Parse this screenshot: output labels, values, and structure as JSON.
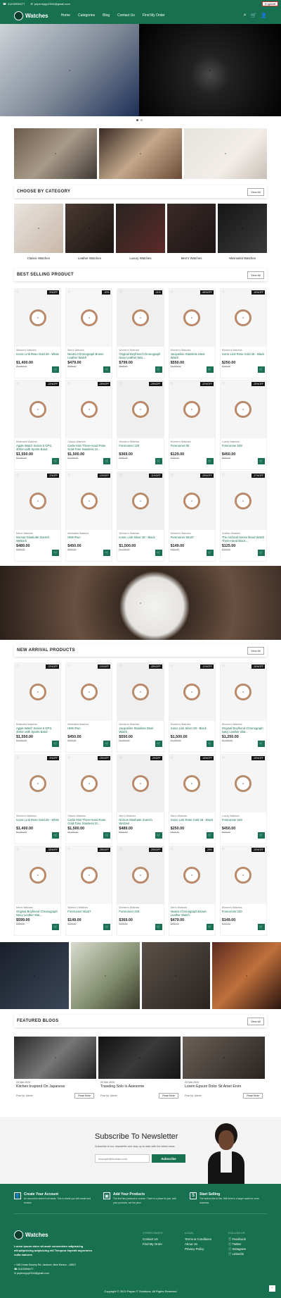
{
  "topbar": {
    "phone": "01433994477",
    "email": "pepeveppp2344@gmail.com",
    "language": "English"
  },
  "nav": {
    "brand": "Watches",
    "menu": [
      "Home",
      "Categories",
      "Blog",
      "Contact Us",
      "Find My Order"
    ],
    "cart_count": "0"
  },
  "category": {
    "title": "CHOOSE BY CATEGORY",
    "view_all": "View All",
    "items": [
      "Classic Watches",
      "Leather Watches",
      "Luxury Watches",
      "Men's Watches",
      "Minimalist Watches"
    ]
  },
  "best": {
    "title": "BEST SELLING PRODUCT",
    "view_all": "View All",
    "products": [
      {
        "cat": "Women's Watches",
        "name": "Iconic Link Rose Gold 28 - White",
        "price": "$1,400.00",
        "old": "$1,550.00",
        "badge": "-9%OFF"
      },
      {
        "cat": "Men's Watches",
        "name": "Neutra Chronograph Brown Leather Watch",
        "price": "$479.00",
        "old": "$599.00",
        "badge": "-20%"
      },
      {
        "cat": "Women's Watches",
        "name": "Original Boyfriend Chronograph Navy Leather Wat...",
        "price": "$799.00",
        "old": "$899.00",
        "badge": "-11%"
      },
      {
        "cat": "Women's Watches",
        "name": "Jacqueline Stainless Steel Watch",
        "price": "$550.00",
        "old": "$1,000.00",
        "badge": "-45%OFF"
      },
      {
        "cat": "Women's Watches",
        "name": "Iconic Link Rose Gold 28 - Black",
        "price": "$250.00",
        "old": "$300.00",
        "badge": "-16%OFF"
      },
      {
        "cat": "Minimalist Watches",
        "name": "Apple Watch Series 6 GPS, 40mm with Sports Band",
        "price": "$1,550.00",
        "old": "$2,000.00",
        "badge": "-22%OFF"
      },
      {
        "cat": "Classic Watches",
        "name": "Carlie Mini Three-Hand Rose Gold-Tone Stainless St...",
        "price": "$1,500.00",
        "old": "$2,000.00",
        "badge": "-25%OFF"
      },
      {
        "cat": "Women's Watches",
        "name": "Forerunner 220",
        "price": "$369.00",
        "old": "$489.00",
        "badge": "-25%OFF"
      },
      {
        "cat": "Women's Watches",
        "name": "Forerunner 55",
        "price": "$129.00",
        "old": "$189.00",
        "badge": "-32%OFF"
      },
      {
        "cat": "Luxury Watches",
        "name": "Forerunner 539",
        "price": "$450.00",
        "old": "$600.00",
        "badge": "-25%OFF"
      },
      {
        "cat": "Men's Watches",
        "name": "Nomos Glashutte Zuerich Weltzeit",
        "price": "$489.00",
        "old": "$500.00",
        "badge": "-2%OFF"
      },
      {
        "cat": "Minimalist Watches",
        "name": "HMH Run",
        "price": "$450.00",
        "old": "$500.00",
        "badge": "-10%OFF"
      },
      {
        "cat": "Women's Watches",
        "name": "Iconic Link Silver 28 - Black",
        "price": "$1,500.00",
        "old": "$1,700.00",
        "badge": "-11%OFF"
      },
      {
        "cat": "Women's Watches",
        "name": "Forerunner 55167",
        "price": "$149.00",
        "old": "$200.00",
        "badge": "-25%OFF"
      },
      {
        "cat": "Leather Watches",
        "name": "The Archival Series Mood Watch Three-Hand Black...",
        "price": "$125.00",
        "old": "$200.00",
        "badge": "-37%OFF"
      }
    ]
  },
  "arrival": {
    "title": "NEW ARRIVAL PRODUCTS",
    "view_all": "View All",
    "products": [
      {
        "cat": "Minimalist Watches",
        "name": "Apple Watch Series 6 GPS, 40mm with Sports Band",
        "price": "$1,550.00",
        "old": "$2,000.00",
        "badge": "-22%OFF"
      },
      {
        "cat": "Minimalist Watches",
        "name": "HMH Run",
        "price": "$450.00",
        "old": "$500.00",
        "badge": "-10%OFF"
      },
      {
        "cat": "Women's Watches",
        "name": "Jacqueline Stainless Steel Watch",
        "price": "$550.00",
        "old": "$1,000.00",
        "badge": "-45%OFF"
      },
      {
        "cat": "Women's Watches",
        "name": "Iconic Link Silver 28 - Black",
        "price": "$1,500.00",
        "old": "$1,700.00",
        "badge": "-11%OFF"
      },
      {
        "cat": "Women's Watches",
        "name": "Original Boyfriend Chronograph Navy Leather Wat...",
        "price": "$1,250.00",
        "old": "$1,700.00",
        "badge": "-26%OFF"
      },
      {
        "cat": "Women's Watches",
        "name": "Iconic Link Rose Gold 28 - White",
        "price": "$1,400.00",
        "old": "$1,550.00",
        "badge": "-9%OFF"
      },
      {
        "cat": "Classic Watches",
        "name": "Carlie Mini Three-Hand Rose Gold-Tone Stainless St...",
        "price": "$1,500.00",
        "old": "$2,000.00",
        "badge": "-25%OFF"
      },
      {
        "cat": "Men's Watches",
        "name": "Nomos Glashutte Zuerich Weltzeit",
        "price": "$489.00",
        "old": "$500.00",
        "badge": "-2%OFF"
      },
      {
        "cat": "Men's Watches",
        "name": "Iconic Link Rose Gold 28 - Black",
        "price": "$250.00",
        "old": "$300.00",
        "badge": "-16%OFF"
      },
      {
        "cat": "Luxury Watches",
        "name": "Forerunner 539",
        "price": "$450.00",
        "old": "$600.00",
        "badge": "-25%OFF"
      },
      {
        "cat": "Men's Watches",
        "name": "Original Boyfriend Chronograph Navy Leather Wat...",
        "price": "$599.00",
        "old": "$899.00",
        "badge": "-33%OFF"
      },
      {
        "cat": "Women's Watches",
        "name": "Forerunner 55167",
        "price": "$149.00",
        "old": "$200.00",
        "badge": "-25%OFF"
      },
      {
        "cat": "Women's Watches",
        "name": "Forerunner 220",
        "price": "$369.00",
        "old": "$489.00",
        "badge": "-25%OFF"
      },
      {
        "cat": "Men's Watches",
        "name": "Neutra Chronograph Brown Leather Watch",
        "price": "$479.00",
        "old": "$599.00",
        "badge": "-20%"
      },
      {
        "cat": "Women's Watches",
        "name": "Forerunner 230",
        "price": "$149.00",
        "old": "$200.00",
        "badge": "-25%OFF"
      }
    ]
  },
  "blogs": {
    "title": "FEATURED BLOGS",
    "view_all": "View All",
    "items": [
      {
        "date": "25 Mar 2023",
        "title": "Kitchen Inspired On Japanese",
        "by": "Post by: Admin",
        "more": "Read More"
      },
      {
        "date": "25 Mar 2023",
        "title": "Traveling Solo Is Awesome",
        "by": "Post by: Admin",
        "more": "Read More"
      },
      {
        "date": "25 Mar 2023",
        "title": "Lorem Epsum Dolor Sit Amet Enim",
        "by": "Post by: Admin",
        "more": "Read More"
      }
    ]
  },
  "newsletter": {
    "title": "Subscribe To Newsletter",
    "text": "Subscribe to our newsletter and stay up to date with the latest news.",
    "placeholder": "example@domain.com",
    "button": "Subscribe"
  },
  "footer": {
    "features": [
      {
        "title": "Create Your Account",
        "text": "An account is where it all starts. This is where you will create and browse."
      },
      {
        "title": "Add Your Products",
        "text": "The first few products in a store. There is a place for you. Add your products, set the price."
      },
      {
        "title": "Start Selling",
        "text": "The bottom line is this. Still there is a larger scale for more business."
      }
    ],
    "brand": "Watches",
    "about": "Lorem ipsum dolor sit amet consectetur adipisicing elit.adipisicing adipisicing elit Tempora impedit asperiores nulla maiores",
    "address": "348 Cedar Swamp Rd, Jackson, New Mexico - 08527",
    "phone": "01433994477",
    "email": "pepeveppp2344@gmail.com",
    "col1": {
      "title": "OTHER PAGES",
      "links": [
        "Contact Us",
        "Find My Order"
      ]
    },
    "col2": {
      "title": "LEGAL",
      "links": [
        "Terms & Conditions",
        "About Us",
        "Privacy Policy"
      ]
    },
    "col3": {
      "title": "FOLLOW US",
      "links": [
        "Facebook",
        "Twitter",
        "Instagram",
        "LinkedIn"
      ]
    },
    "copyright": "Copyright © 2023 Papon IT Solutions. All Rights Reserved"
  },
  "colors": {
    "brand": "#17704f"
  }
}
